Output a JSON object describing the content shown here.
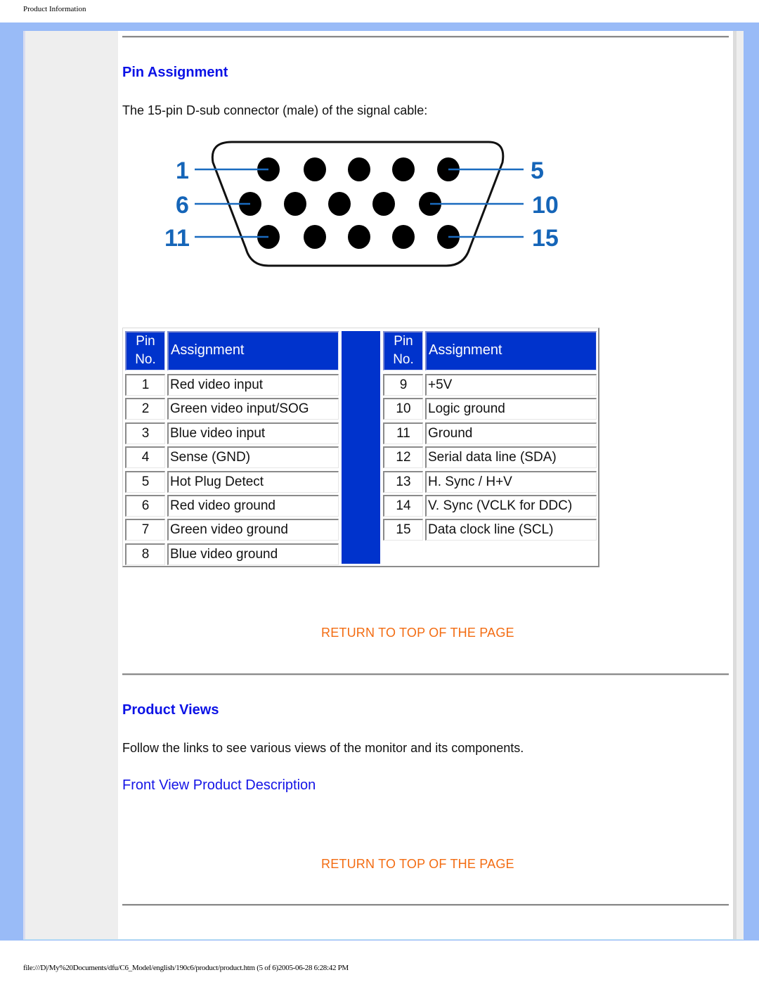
{
  "page": {
    "header_caption": "Product Information",
    "footer_path": "file:///D|/My%20Documents/dfu/C6_Model/english/190c6/product/product.htm (5 of 6)2005-06-28 6:28:42 PM"
  },
  "colors": {
    "band_blue": "#99bbf7",
    "heading_blue": "#0b12e6",
    "table_header_blue": "#0033cc",
    "return_link_orange": "#f36c12",
    "sidebar_gray": "#eeeeee"
  },
  "pin_assignment": {
    "title": "Pin Assignment",
    "intro": "The 15-pin D-sub connector (male) of the signal cable:",
    "diagram": {
      "icon": "vga-connector-diagram",
      "labels": [
        "1",
        "5",
        "6",
        "10",
        "11",
        "15"
      ],
      "rows": [
        5,
        5,
        5
      ]
    },
    "table": {
      "header_pin_line1": "Pin",
      "header_pin_line2": "No.",
      "header_assignment": "Assignment",
      "left": [
        {
          "pin": "1",
          "assignment": "Red video input"
        },
        {
          "pin": "2",
          "assignment": "Green video input/SOG"
        },
        {
          "pin": "3",
          "assignment": "Blue video input"
        },
        {
          "pin": "4",
          "assignment": "Sense (GND)"
        },
        {
          "pin": "5",
          "assignment": "Hot Plug Detect"
        },
        {
          "pin": "6",
          "assignment": "Red video ground"
        },
        {
          "pin": "7",
          "assignment": "Green video ground"
        },
        {
          "pin": "8",
          "assignment": "Blue video ground"
        }
      ],
      "right": [
        {
          "pin": "9",
          "assignment": "+5V"
        },
        {
          "pin": "10",
          "assignment": "Logic ground"
        },
        {
          "pin": "11",
          "assignment": "Ground"
        },
        {
          "pin": "12",
          "assignment": "Serial data line (SDA)"
        },
        {
          "pin": "13",
          "assignment": "H. Sync / H+V"
        },
        {
          "pin": "14",
          "assignment": "V. Sync (VCLK for DDC)"
        },
        {
          "pin": "15",
          "assignment": "Data clock line (SCL)"
        }
      ]
    },
    "return_link": "RETURN TO TOP OF THE PAGE"
  },
  "product_views": {
    "title": "Product Views",
    "intro": "Follow the links to see various views of the monitor and its components.",
    "links": [
      "Front View Product Description"
    ],
    "return_link": "RETURN TO TOP OF THE PAGE"
  }
}
